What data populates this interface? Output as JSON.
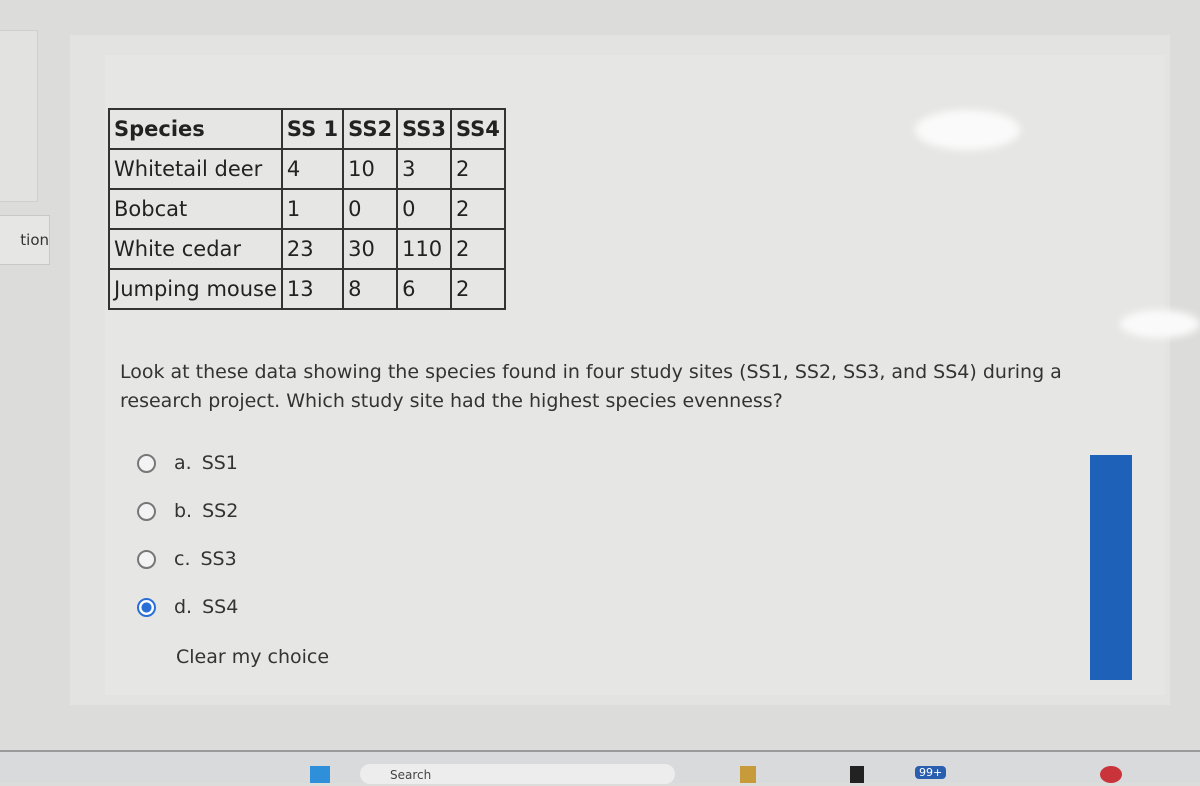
{
  "sidebar": {
    "label": "tion"
  },
  "table": {
    "headers": [
      "Species",
      "SS 1",
      "SS2",
      "SS3",
      "SS4"
    ],
    "rows": [
      [
        "Whitetail deer",
        "4",
        "10",
        "3",
        "2"
      ],
      [
        "Bobcat",
        "1",
        "0",
        "0",
        "2"
      ],
      [
        "White cedar",
        "23",
        "30",
        "110",
        "2"
      ],
      [
        "Jumping mouse",
        "13",
        "8",
        "6",
        "2"
      ]
    ]
  },
  "question": "Look at these data showing the species found in four study sites (SS1, SS2, SS3, and SS4) during a research project. Which study site had the highest species evenness?",
  "options": [
    {
      "letter": "a.",
      "label": "SS1",
      "selected": false
    },
    {
      "letter": "b.",
      "label": "SS2",
      "selected": false
    },
    {
      "letter": "c.",
      "label": "SS3",
      "selected": false
    },
    {
      "letter": "d.",
      "label": "SS4",
      "selected": true
    }
  ],
  "clear_label": "Clear my choice",
  "taskbar": {
    "search": "Search",
    "badge": "99+"
  },
  "colors": {
    "accent": "#2a6fd6"
  }
}
